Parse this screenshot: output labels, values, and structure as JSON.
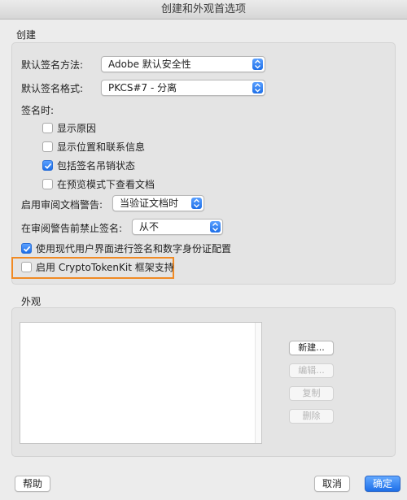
{
  "window": {
    "title": "创建和外观首选项"
  },
  "create_section": {
    "label": "创建",
    "default_method": {
      "label": "默认签名方法:",
      "value": "Adobe 默认安全性"
    },
    "default_format": {
      "label": "默认签名格式:",
      "value": "PKCS#7 - 分离"
    },
    "when_signing": {
      "label": "签名时:",
      "options": [
        {
          "label": "显示原因",
          "checked": false
        },
        {
          "label": "显示位置和联系信息",
          "checked": false
        },
        {
          "label": "包括签名吊销状态",
          "checked": true
        },
        {
          "label": "在预览模式下查看文档",
          "checked": false
        }
      ]
    },
    "review_warning": {
      "label": "启用审阅文档警告:",
      "value": "当验证文档时"
    },
    "prevent_signing": {
      "label": "在审阅警告前禁止签名:",
      "value": "从不"
    },
    "modern_ui": {
      "label": "使用现代用户界面进行签名和数字身份证配置",
      "checked": true
    },
    "cryptotokenkit": {
      "label": "启用 CryptoTokenKit 框架支持",
      "checked": false
    }
  },
  "appearance_section": {
    "label": "外观",
    "buttons": {
      "new": "新建...",
      "edit": "编辑...",
      "copy": "复制",
      "delete": "删除"
    }
  },
  "footer": {
    "help": "帮助",
    "cancel": "取消",
    "ok": "确定"
  },
  "colors": {
    "accent": "#1e6fe8",
    "highlight": "#f08a24"
  }
}
